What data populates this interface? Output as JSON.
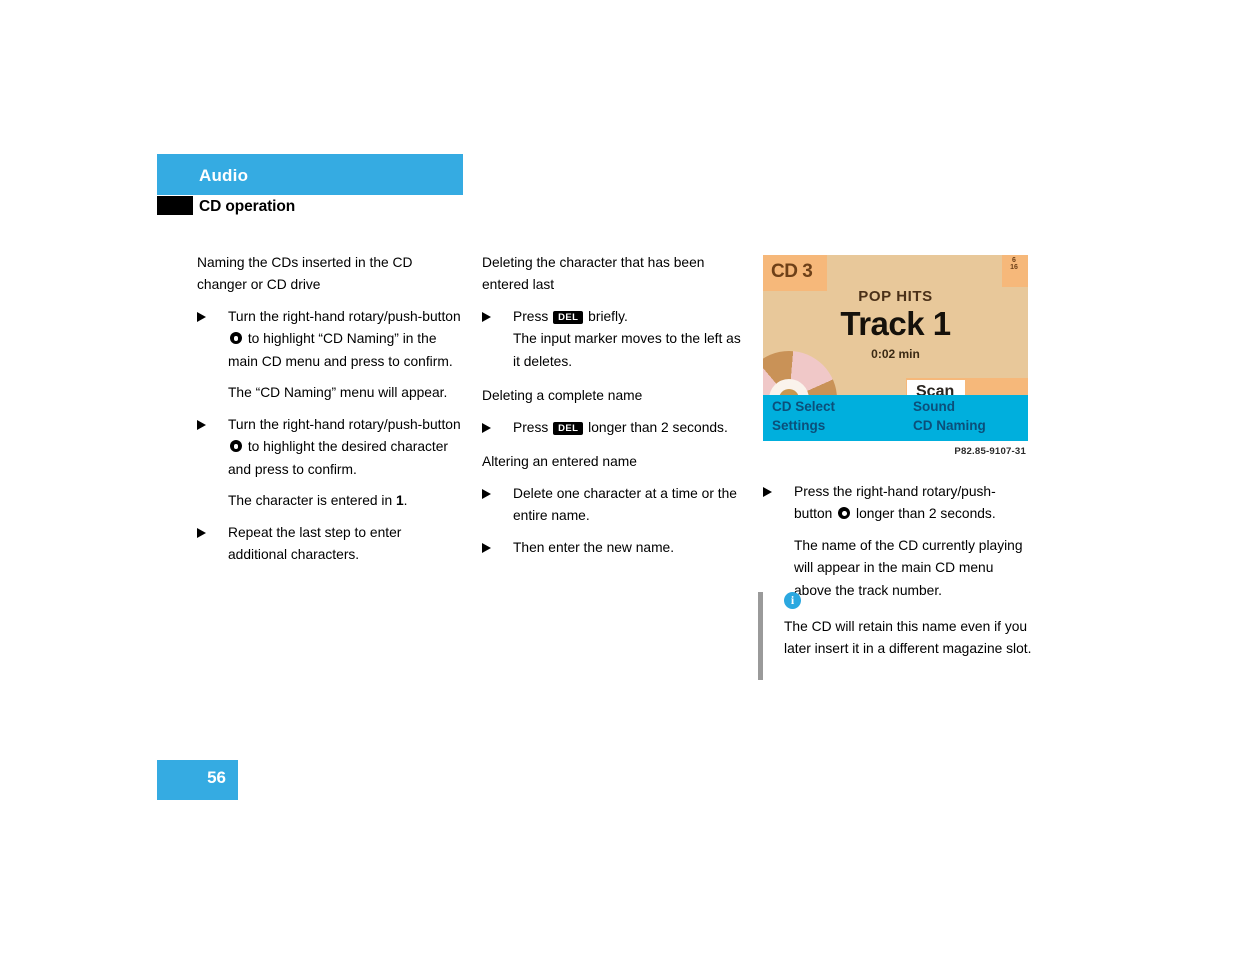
{
  "header": {
    "title": "Audio",
    "subtitle": "CD operation",
    "band_color": "#35ABE2",
    "marker_color": "#000000"
  },
  "page_number": "56",
  "columns": {
    "left": {
      "intro": "Naming the CDs inserted in the CD changer or CD drive",
      "step1_part1": "Turn the right-hand rotary/push-button",
      "step1_part2": "to highlight “CD Naming” in the main CD menu and press to confirm.",
      "step1_result": "The “CD Naming” menu will appear.",
      "step2_part1": "Turn the right-hand rotary/push-button",
      "step2_part2": "to highlight the desired character and press to confirm.",
      "step2_result_pre": "The character is entered in",
      "step2_result_ref": "1",
      "step2_result_post": ".",
      "step3": "Repeat the last step to enter additional characters."
    },
    "middle": {
      "heading1": "Deleting the character that has been entered last",
      "step1_pre": "Press",
      "step1_key": "DEL",
      "step1_post": "briefly.",
      "step1_result": "The input marker moves to the left as it deletes.",
      "heading2": "Deleting a complete name",
      "step2_pre": "Press",
      "step2_key": "DEL",
      "step2_post": "longer than 2 seconds.",
      "heading3": "Altering an entered name",
      "step3": "Delete one character at a time or the entire name.",
      "step4": "Then enter the new name."
    },
    "right": {
      "step_pre": "Press the right-hand rotary/push-button",
      "step_post": "longer than 2 seconds.",
      "step_result": "The name of the CD currently playing will appear in the main CD menu above the track number.",
      "note_icon": "info-icon",
      "note_text": "The CD will retain this name even if you later insert it in a different magazine slot."
    }
  },
  "display": {
    "cd_badge": "CD 3",
    "corner_badge": "6\n16",
    "disc_name": "POP HITS",
    "track_label": "Track 1",
    "track_time": "0:02 min",
    "scan_button": "Scan",
    "menu": {
      "cd_select": "CD Select",
      "settings": "Settings",
      "sound": "Sound",
      "cd_naming": "CD Naming"
    },
    "caption": "P82.85-9107-31",
    "colors": {
      "screen_bg": "#E8C89A",
      "badge_bg": "#F6B87A",
      "menu_bar": "#00AFDD",
      "menu_text": "#0B4F7A"
    }
  }
}
